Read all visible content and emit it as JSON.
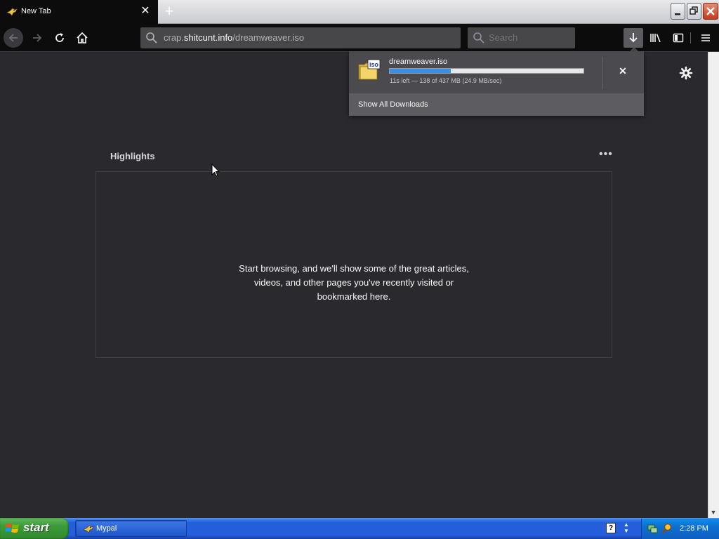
{
  "tab": {
    "title": "New Tab",
    "new_tab_symbol": "+"
  },
  "toolbar": {
    "url_prefix": "crap.",
    "url_domain": "shitcunt.info",
    "url_path": "/dreamweaver.iso",
    "search_placeholder": "Search"
  },
  "downloads": {
    "file_name": "dreamweaver.iso",
    "file_type_badge": "iso",
    "progress_fraction": 0.316,
    "status": "11s left — 138 of 437 MB (24.9 MB/sec)",
    "show_all": "Show All Downloads"
  },
  "highlights": {
    "title": "Highlights",
    "menu_symbol": "•••",
    "empty_message": "Start browsing, and we'll show some of the great articles, videos, and other pages you've recently visited or bookmarked here."
  },
  "taskbar": {
    "start_label": "start",
    "task_label": "Mypal",
    "help_symbol": "?",
    "clock": "2:28 PM"
  },
  "colors": {
    "toolbar_bg": "#0c0c0d",
    "page_bg": "#2a2a2e",
    "progress": "#3a8ee6",
    "taskbar_blue": "#245edb",
    "start_green": "#3c9a3a"
  }
}
